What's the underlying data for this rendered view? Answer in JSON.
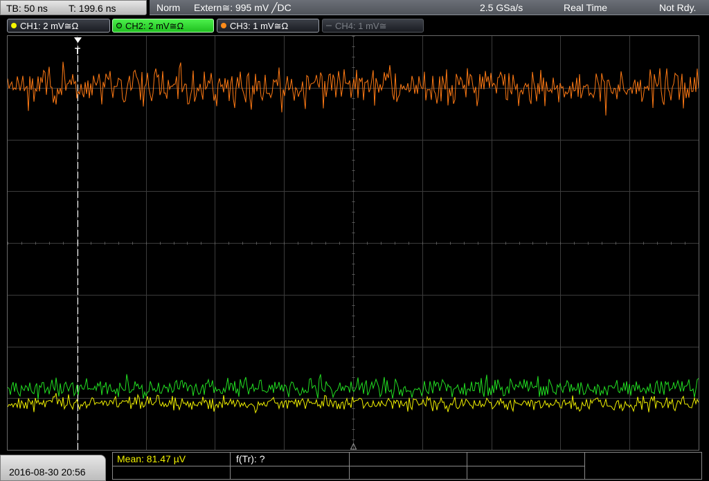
{
  "timebase": {
    "tb": "TB: 50 ns",
    "t": "T: 199.6 ns"
  },
  "status": {
    "mode": "Norm",
    "trigger": "Extern≅: 995 mV ╱DC",
    "sample_rate": "2.5 GSa/s",
    "acq": "Real Time",
    "state": "Not Rdy."
  },
  "channels": [
    {
      "label": "CH1: 2 mV≅Ω",
      "color": "#f5f500",
      "state": "normal"
    },
    {
      "label": "CH2: 2 mV≅Ω",
      "color": "#22dd22",
      "state": "active"
    },
    {
      "label": "CH3: 1 mV≅Ω",
      "color": "#ff8c1a",
      "state": "normal"
    },
    {
      "label": "CH4: 1 mV≅",
      "color": "#6a6e74",
      "state": "disabled"
    }
  ],
  "trigger_marker": "T",
  "traces": {
    "ch3": {
      "color": "#ff7a14",
      "level_div": 1.0,
      "amp_div": 0.35,
      "seed": 7
    },
    "ch2": {
      "color": "#22e022",
      "level_div": 6.8,
      "amp_div": 0.17,
      "seed": 11
    },
    "ch1": {
      "color": "#f0f000",
      "level_div": 7.1,
      "amp_div": 0.14,
      "seed": 23
    }
  },
  "grid": {
    "hdiv": 10,
    "vdiv": 8
  },
  "bottom": {
    "datetime": "2016-08-30 20:56",
    "mean": "Mean: 81.47 µV",
    "ftr": "f(Tr): ?"
  }
}
